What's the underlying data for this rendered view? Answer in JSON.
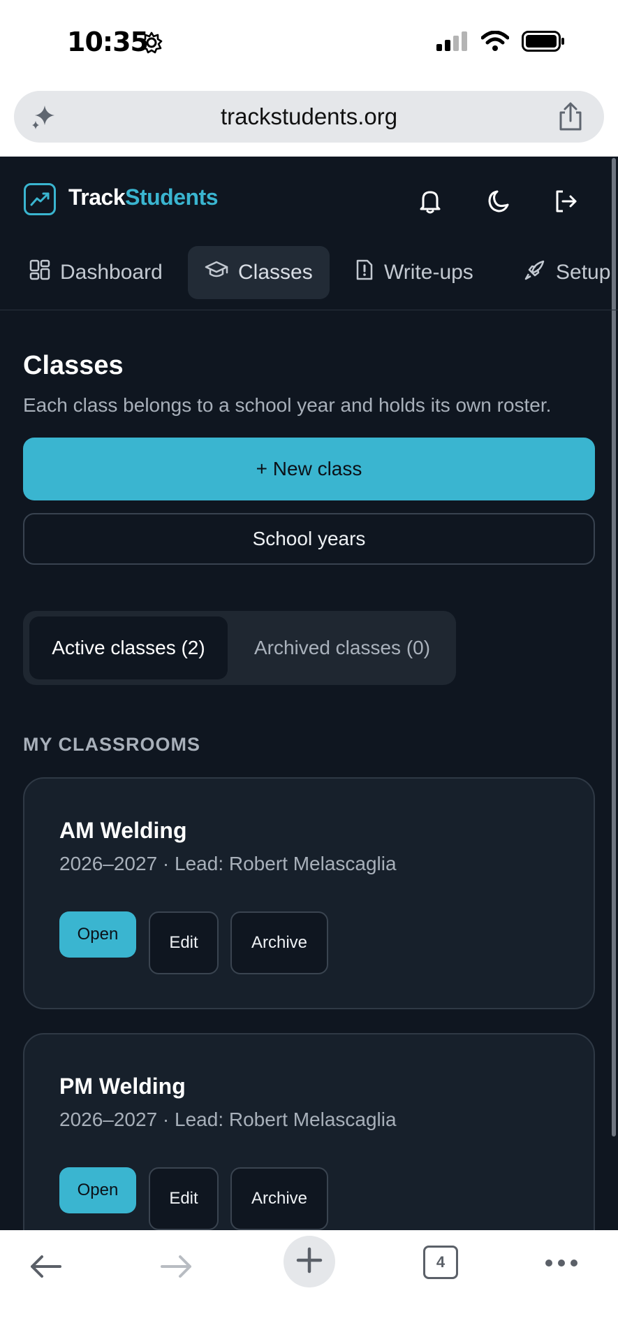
{
  "status_bar": {
    "time": "10:35",
    "icons": [
      "gear-icon",
      "signal-icon",
      "wifi-icon",
      "battery-icon"
    ]
  },
  "url_bar": {
    "url": "trackstudents.org",
    "icons": [
      "sparkle-icon",
      "share-icon"
    ]
  },
  "header": {
    "brand_part1": "Track",
    "brand_part2": "Students",
    "icons": [
      "bell-icon",
      "moon-icon",
      "logout-icon"
    ]
  },
  "nav": {
    "items": [
      {
        "label": "Dashboard",
        "icon": "grid-icon"
      },
      {
        "label": "Classes",
        "icon": "graduation-cap-icon",
        "active": true
      },
      {
        "label": "Write-ups",
        "icon": "alert-file-icon"
      },
      {
        "label": "Setup",
        "icon": "rocket-icon"
      }
    ]
  },
  "page": {
    "title": "Classes",
    "subtitle": "Each class belongs to a school year and holds its own roster.",
    "new_class_button": "+ New class",
    "school_years_button": "School years",
    "tabs": {
      "active": "Active classes (2)",
      "archived": "Archived classes (0)"
    },
    "section_label": "MY CLASSROOMS",
    "classes": [
      {
        "name": "AM Welding",
        "meta": "2026–2027 · Lead: Robert Melascaglia",
        "open": "Open",
        "edit": "Edit",
        "archive": "Archive"
      },
      {
        "name": "PM Welding",
        "meta": "2026–2027 · Lead: Robert Melascaglia",
        "open": "Open",
        "edit": "Edit",
        "archive": "Archive"
      }
    ]
  },
  "toolbar": {
    "tab_count": "4",
    "icons": [
      "back-arrow-icon",
      "forward-arrow-icon",
      "plus-icon",
      "tabs-icon",
      "more-icon"
    ]
  },
  "colors": {
    "accent": "#3ab5d0",
    "background": "#0f1620",
    "card": "#17202b"
  }
}
